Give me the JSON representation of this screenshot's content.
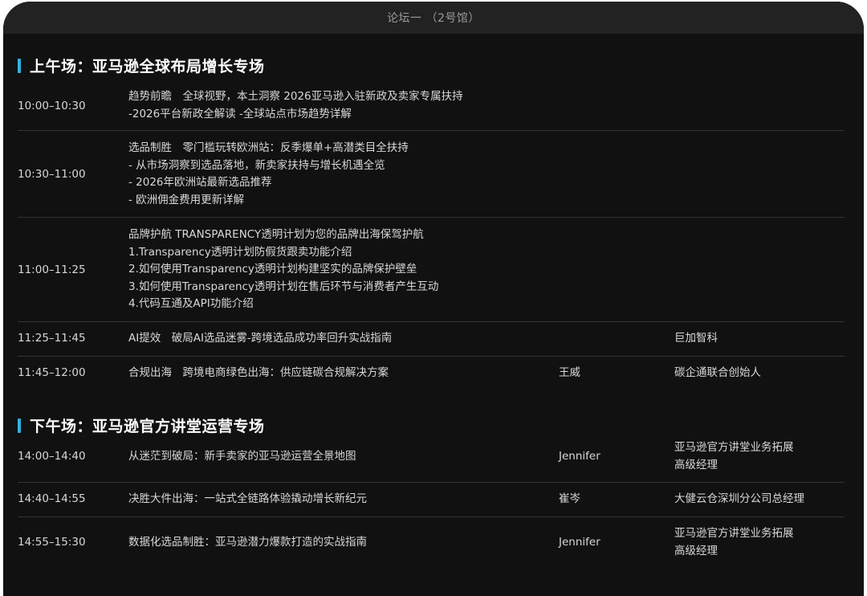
{
  "header": {
    "title": "论坛一 （2号馆）"
  },
  "morning": {
    "section_title": "上午场：亚马逊全球布局增长专场",
    "rows": [
      {
        "time": "10:00–10:30",
        "lines": [
          "趋势前瞻　全球视野，本土洞察 2026亚马逊入驻新政及卖家专属扶持",
          "-2026平台新政全解读  -全球站点市场趋势详解"
        ],
        "speaker": "",
        "title_lines": []
      },
      {
        "time": "10:30–11:00",
        "lines": [
          "选品制胜　零门槛玩转欧洲站：反季爆单+高潜类目全扶持",
          "- 从市场洞察到选品落地，新卖家扶持与增长机遇全览",
          "- 2026年欧洲站最新选品推荐",
          "- 欧洲佣金费用更新详解"
        ],
        "speaker": "",
        "title_lines": []
      },
      {
        "time": "11:00–11:25",
        "lines": [
          "品牌护航  TRANSPARENCY透明计划为您的品牌出海保驾护航",
          "1.Transparency透明计划防假货跟卖功能介绍",
          "2.如何使用Transparency透明计划构建坚实的品牌保护壁垒",
          "3.如何使用Transparency透明计划在售后环节与消费者产生互动",
          "4.代码互通及API功能介绍"
        ],
        "speaker": "",
        "title_lines": []
      },
      {
        "time": "11:25–11:45",
        "lines": [
          "AI提效　破局AI选品迷雾-跨境选品成功率回升实战指南"
        ],
        "speaker": "",
        "title_lines": [
          "巨加智科"
        ]
      },
      {
        "time": "11:45–12:00",
        "lines": [
          "合规出海　跨境电商绿色出海：供应链碳合规解决方案"
        ],
        "speaker": "王威",
        "title_lines": [
          "碳企通联合创始人"
        ]
      }
    ]
  },
  "afternoon": {
    "section_title": "下午场：亚马逊官方讲堂运营专场",
    "rows": [
      {
        "time": "14:00–14:40",
        "lines": [
          "从迷茫到破局：新手卖家的亚马逊运营全景地图"
        ],
        "speaker": "Jennifer",
        "title_lines": [
          "亚马逊官方讲堂业务拓展",
          "高级经理"
        ]
      },
      {
        "time": "14:40–14:55",
        "lines": [
          "决胜大件出海：一站式全链路体验撬动增长新纪元"
        ],
        "speaker": "崔岑",
        "title_lines": [
          "大健云仓深圳分公司总经理"
        ]
      },
      {
        "time": "14:55–15:30",
        "lines": [
          "数据化选品制胜：亚马逊潜力爆款打造的实战指南"
        ],
        "speaker": "Jennifer",
        "title_lines": [
          "亚马逊官方讲堂业务拓展",
          "高级经理"
        ]
      }
    ]
  }
}
